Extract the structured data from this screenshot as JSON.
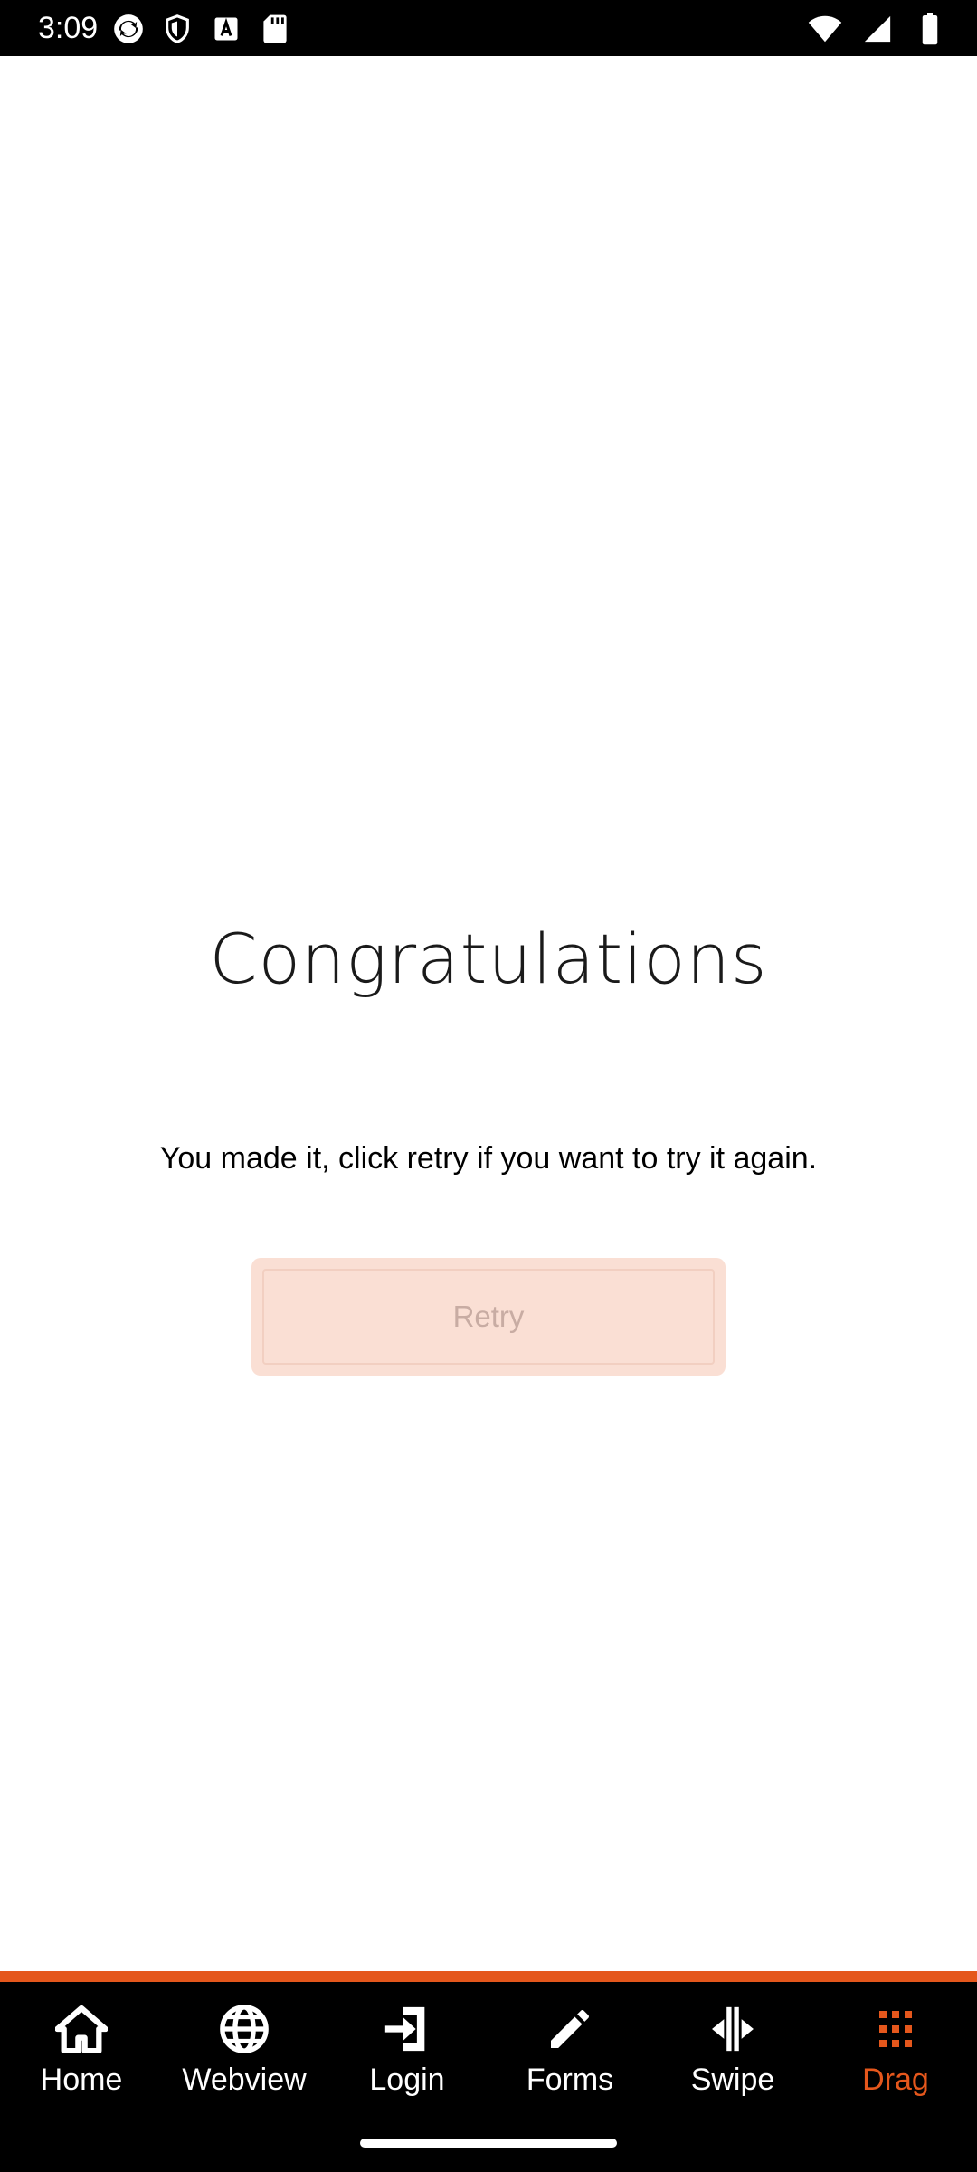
{
  "status_bar": {
    "time": "3:09",
    "left_icons": [
      "sync-icon",
      "shield-icon",
      "text-a-icon",
      "sd-card-icon"
    ],
    "right_icons": [
      "wifi-icon",
      "signal-icon",
      "battery-icon"
    ]
  },
  "main": {
    "title": "Congratulations",
    "message": "You made it, click retry if you want to try it again.",
    "retry_label": "Retry"
  },
  "bottom_nav": {
    "active": "Drag",
    "items": [
      {
        "label": "Home",
        "icon": "home-icon"
      },
      {
        "label": "Webview",
        "icon": "globe-icon"
      },
      {
        "label": "Login",
        "icon": "login-icon"
      },
      {
        "label": "Forms",
        "icon": "pencil-icon"
      },
      {
        "label": "Swipe",
        "icon": "swipe-icon"
      },
      {
        "label": "Drag",
        "icon": "drag-grid-icon"
      }
    ]
  },
  "colors": {
    "accent": "#e5571c",
    "nav_background": "#000000",
    "retry_background": "#fadfd4",
    "retry_text": "#c8aca3"
  }
}
